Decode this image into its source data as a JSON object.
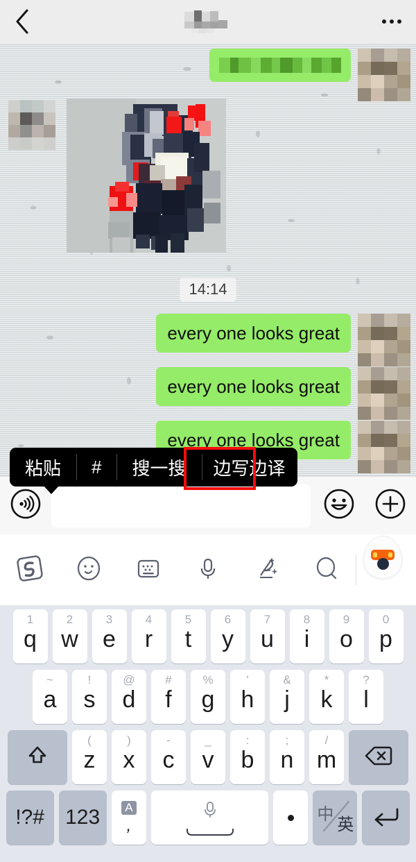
{
  "header": {
    "back_icon": "chevron-left-icon",
    "title": "",
    "title_state": "blurred",
    "more_icon": "ellipsis-icon"
  },
  "chat": {
    "timestamp": "14:14",
    "messages": [
      {
        "type": "text",
        "direction": "outgoing",
        "text": "",
        "censored": true
      },
      {
        "type": "image",
        "direction": "incoming",
        "alt": "pixelated-photo"
      },
      {
        "type": "text",
        "direction": "outgoing",
        "text": "every one looks great"
      },
      {
        "type": "text",
        "direction": "outgoing",
        "text": "every one looks great"
      },
      {
        "type": "text",
        "direction": "outgoing",
        "text": "every one looks great"
      }
    ],
    "bubble_color": "#95ec69",
    "background_color": "#dfe3e4"
  },
  "context_menu": {
    "items": [
      {
        "label": "粘贴",
        "highlighted": false
      },
      {
        "label": "#",
        "highlighted": false
      },
      {
        "label": "搜一搜",
        "highlighted": false
      },
      {
        "label": "边写边译",
        "highlighted": true
      }
    ],
    "highlight_color": "#f60c0c",
    "background_color": "#000000"
  },
  "input_bar": {
    "voice_icon": "voice-wave-icon",
    "field_value": "",
    "field_placeholder": "",
    "emoji_icon": "smiley-icon",
    "plus_icon": "plus-circle-icon"
  },
  "keyboard": {
    "toolbar": [
      {
        "icon": "sogou-logo-icon",
        "name": "sogou-logo"
      },
      {
        "icon": "smiley-icon",
        "name": "emoji"
      },
      {
        "icon": "keyboard-icon",
        "name": "keyboard-layout"
      },
      {
        "icon": "microphone-icon",
        "name": "voice-input"
      },
      {
        "icon": "handwriting-icon",
        "name": "handwriting"
      },
      {
        "icon": "search-icon",
        "name": "search"
      },
      {
        "icon": "chevron-down-icon",
        "name": "collapse-keyboard"
      }
    ],
    "mascot_icon": "sogou-mascot-icon",
    "rows": [
      [
        {
          "main": "q",
          "hint": "1"
        },
        {
          "main": "w",
          "hint": "2"
        },
        {
          "main": "e",
          "hint": "3"
        },
        {
          "main": "r",
          "hint": "4"
        },
        {
          "main": "t",
          "hint": "5"
        },
        {
          "main": "y",
          "hint": "6"
        },
        {
          "main": "u",
          "hint": "7"
        },
        {
          "main": "i",
          "hint": "8"
        },
        {
          "main": "o",
          "hint": "9"
        },
        {
          "main": "p",
          "hint": "0"
        }
      ],
      [
        {
          "main": "a",
          "hint": "~"
        },
        {
          "main": "s",
          "hint": "!"
        },
        {
          "main": "d",
          "hint": "@"
        },
        {
          "main": "f",
          "hint": "#"
        },
        {
          "main": "g",
          "hint": "%"
        },
        {
          "main": "h",
          "hint": "'"
        },
        {
          "main": "j",
          "hint": "&"
        },
        {
          "main": "k",
          "hint": "*"
        },
        {
          "main": "l",
          "hint": "?"
        }
      ],
      [
        {
          "main": "z",
          "hint": "("
        },
        {
          "main": "x",
          "hint": ")"
        },
        {
          "main": "c",
          "hint": "-"
        },
        {
          "main": "v",
          "hint": "_"
        },
        {
          "main": "b",
          "hint": ":"
        },
        {
          "main": "n",
          "hint": ";"
        },
        {
          "main": "m",
          "hint": "/"
        }
      ]
    ],
    "shift_icon": "shift-arrow-icon",
    "backspace_icon": "backspace-icon",
    "bottom_row": {
      "symbols_label": "!?#",
      "numbers_label": "123",
      "ac_top_label": "A",
      "ac_bottom_label": ",",
      "space_icon": "microphone-icon",
      "period_label": ".",
      "lang_zh": "中",
      "lang_en": "英",
      "enter_icon": "return-arrow-icon"
    }
  }
}
